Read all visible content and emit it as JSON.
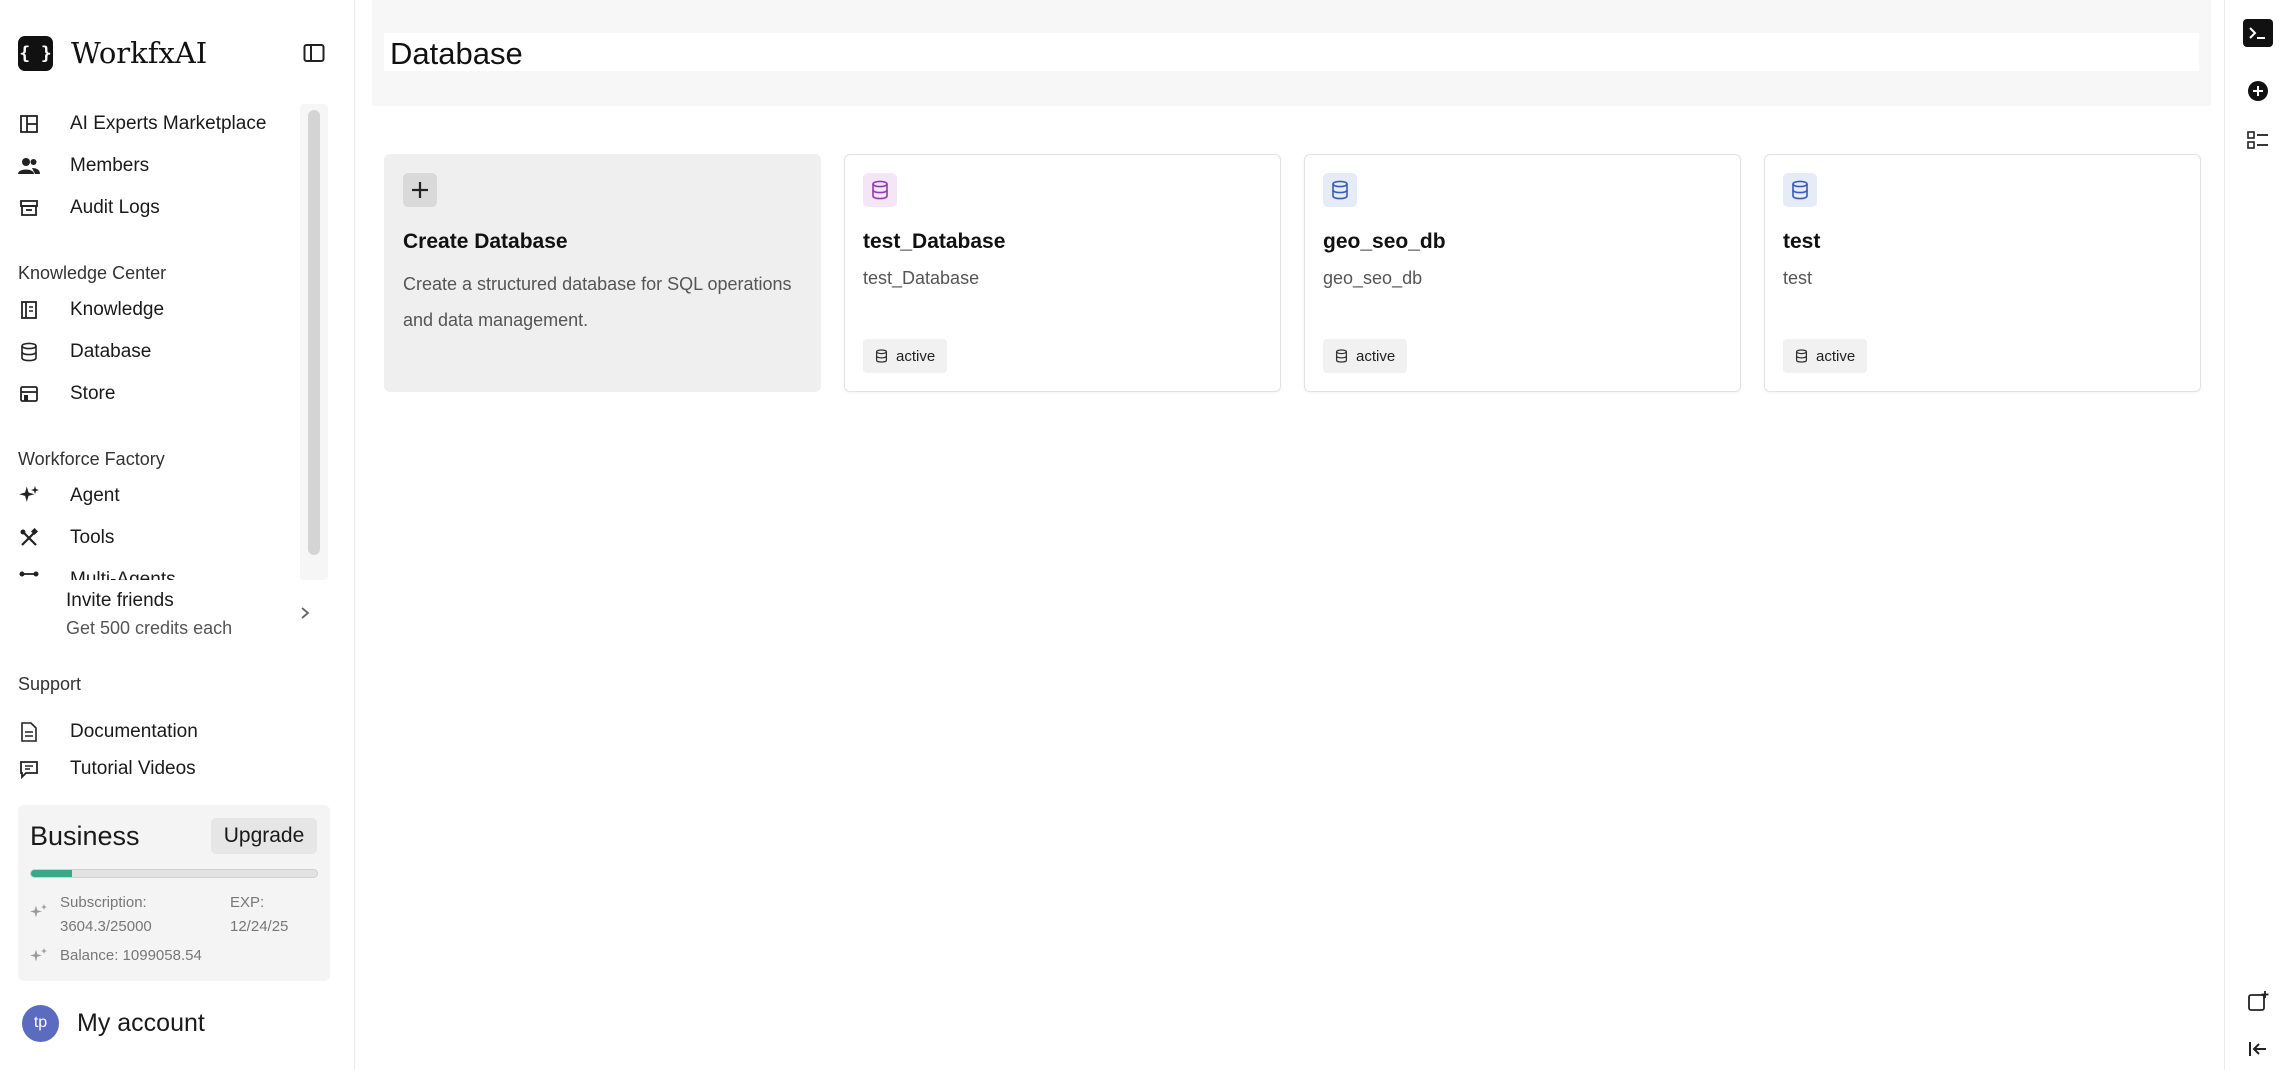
{
  "app": {
    "name": "WorkfxAI",
    "logo_text": "{ }"
  },
  "sidebar": {
    "items": [
      {
        "label": "AI Experts Marketplace",
        "icon": "marketplace-icon"
      },
      {
        "label": "Members",
        "icon": "members-icon"
      },
      {
        "label": "Audit Logs",
        "icon": "archive-icon"
      }
    ],
    "knowledge_center": {
      "title": "Knowledge Center",
      "items": [
        {
          "label": "Knowledge",
          "icon": "book-icon"
        },
        {
          "label": "Database",
          "icon": "database-icon"
        },
        {
          "label": "Store",
          "icon": "store-icon"
        }
      ]
    },
    "workforce_factory": {
      "title": "Workforce Factory",
      "items": [
        {
          "label": "Agent",
          "icon": "sparkles-icon"
        },
        {
          "label": "Tools",
          "icon": "tools-icon"
        },
        {
          "label": "Multi-Agents",
          "icon": "multi-agents-icon"
        }
      ]
    },
    "invite": {
      "title": "Invite friends",
      "subtitle": "Get 500 credits each"
    },
    "support": {
      "title": "Support",
      "items": [
        {
          "label": "Documentation",
          "icon": "document-icon"
        },
        {
          "label": "Tutorial Videos",
          "icon": "video-icon"
        }
      ]
    },
    "plan": {
      "name": "Business",
      "upgrade_label": "Upgrade",
      "progress_fraction": 0.144,
      "subscription_label": "Subscription:",
      "subscription_value": "3604.3/25000",
      "exp_label": "EXP:",
      "exp_value": "12/24/25",
      "balance": "Balance: 1099058.54"
    },
    "account": {
      "initials": "tp",
      "label": "My account"
    }
  },
  "main": {
    "title": "Database",
    "create_card": {
      "title": "Create Database",
      "description": "Create a structured database for SQL operations and data management."
    },
    "databases": [
      {
        "name": "test_Database",
        "subtitle": "test_Database",
        "status": "active",
        "icon_color": "#8e3fa8",
        "icon_bg": "#f5e6f7"
      },
      {
        "name": "geo_seo_db",
        "subtitle": "geo_seo_db",
        "status": "active",
        "icon_color": "#3b5bb5",
        "icon_bg": "#e5ebf7"
      },
      {
        "name": "test",
        "subtitle": "test",
        "status": "active",
        "icon_color": "#3b5bb5",
        "icon_bg": "#e5ebf7"
      }
    ]
  },
  "rail": {
    "buttons": [
      "terminal-icon",
      "add-circle-icon",
      "checklist-icon",
      "new-window-icon",
      "collapse-left-icon"
    ]
  }
}
